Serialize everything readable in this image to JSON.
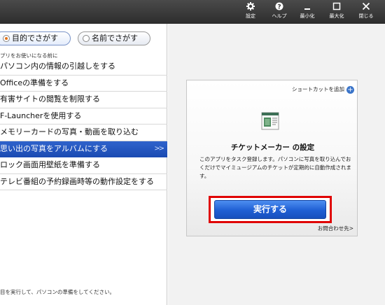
{
  "titlebar": {
    "buttons": [
      {
        "icon": "gear-icon",
        "label": "設定"
      },
      {
        "icon": "help-icon",
        "label": "ヘルプ"
      },
      {
        "icon": "minimize-icon",
        "label": "最小化"
      },
      {
        "icon": "maximize-icon",
        "label": "最大化"
      },
      {
        "icon": "close-icon",
        "label": "閉じる"
      }
    ]
  },
  "tabs": {
    "active": "目的でさがす",
    "inactive": "名前でさがす"
  },
  "left": {
    "notice": "プリをお使いになる前に",
    "items": [
      "パソコン内の情報の引越しをする",
      "Officeの準備をする",
      "有害サイトの閲覧を制限する",
      "F-Launcherを使用する",
      "メモリーカードの写真・動画を取り込む",
      "思い出の写真をアルバムにする",
      "ロック画面用壁紙を準備する",
      "テレビ番組の予約録画時等の動作設定をする"
    ],
    "selected_index": 5,
    "selected_chevron": ">>",
    "footer": "目を実行して、パソコンの準備をしてください。"
  },
  "card": {
    "shortcut_label": "ショートカットを追加",
    "title": "チケットメーカー の設定",
    "description": "このアプリをタスク登録します。パソコンに写真を取り込んでおくだけでマイミュージアムのチケットが定期的に自動作成されます。",
    "run_button": "実行する",
    "contact_link": "お問合わせ先>"
  },
  "colors": {
    "titlebar": "#333333",
    "selected_row": "#2456c0",
    "run_button": "#2a6be0",
    "highlight_frame": "#e00000"
  }
}
